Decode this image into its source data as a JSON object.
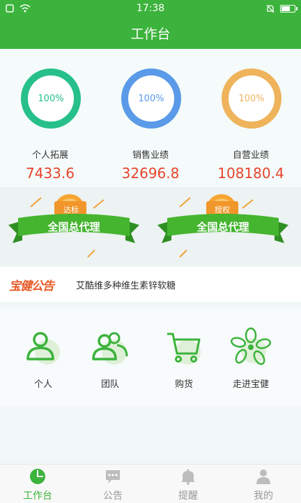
{
  "status_bar": {
    "time": "17:38"
  },
  "nav": {
    "title": "工作台"
  },
  "stats": [
    {
      "label": "个人拓展",
      "value": "7433.6",
      "percent_text": "100%",
      "color": "#27c08a"
    },
    {
      "label": "销售业绩",
      "value": "32696.8",
      "percent_text": "100%",
      "color": "#5a9ae8"
    },
    {
      "label": "自营业绩",
      "value": "108180.4",
      "percent_text": "100%",
      "color": "#efb35c"
    }
  ],
  "badges": [
    {
      "tag": "达标",
      "text": "全国总代理"
    },
    {
      "tag": "授权",
      "text": "全国总代理"
    }
  ],
  "notice": {
    "logo": "宝健公告",
    "text": "艾酷维多种维生素锌软糖"
  },
  "menu": [
    {
      "label": "个人",
      "icon": "person-icon"
    },
    {
      "label": "团队",
      "icon": "team-icon"
    },
    {
      "label": "购货",
      "icon": "shopping-cart-icon"
    },
    {
      "label": "走进宝健",
      "icon": "flower-icon"
    }
  ],
  "tabs": [
    {
      "label": "工作台",
      "icon": "pie-chart-icon",
      "active": true
    },
    {
      "label": "公告",
      "icon": "chat-icon",
      "active": false
    },
    {
      "label": "提醒",
      "icon": "bell-icon",
      "active": false
    },
    {
      "label": "我的",
      "icon": "user-icon",
      "active": false
    }
  ],
  "colors": {
    "primary": "#3cb33c",
    "value_red": "#e8432c",
    "orange": "#e85a26"
  }
}
